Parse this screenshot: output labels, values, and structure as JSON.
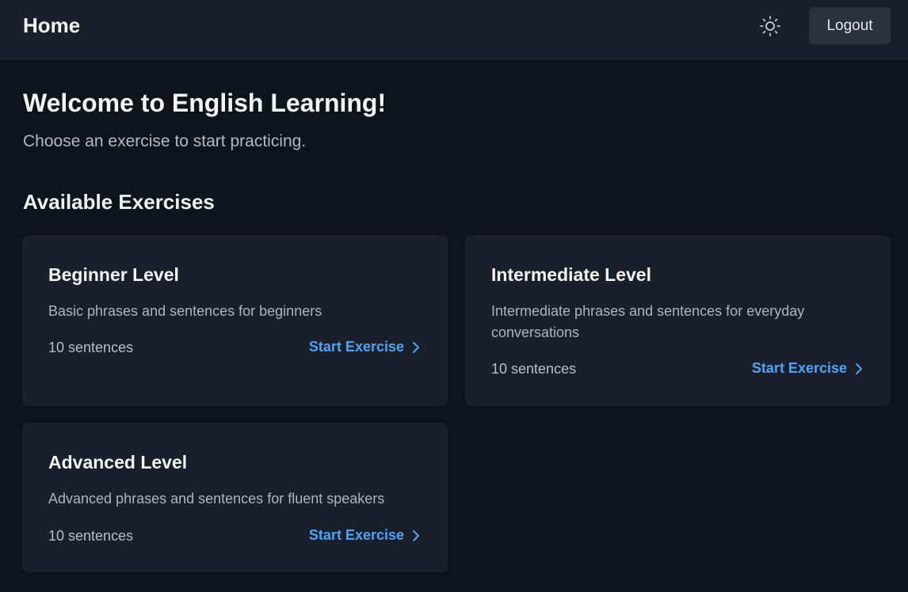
{
  "header": {
    "title": "Home",
    "theme_icon": "sun-icon",
    "logout_label": "Logout"
  },
  "main": {
    "welcome_title": "Welcome to English Learning!",
    "welcome_subtitle": "Choose an exercise to start practicing.",
    "section_title": "Available Exercises",
    "exercises": [
      {
        "title": "Beginner Level",
        "description": "Basic phrases and sentences for beginners",
        "count": "10 sentences",
        "action": "Start Exercise"
      },
      {
        "title": "Intermediate Level",
        "description": "Intermediate phrases and sentences for everyday conversations",
        "count": "10 sentences",
        "action": "Start Exercise"
      },
      {
        "title": "Advanced Level",
        "description": "Advanced phrases and sentences for fluent speakers",
        "count": "10 sentences",
        "action": "Start Exercise"
      }
    ]
  },
  "colors": {
    "background": "#0f131c",
    "surface": "#1a202b",
    "accent": "#4fa3f7",
    "button": "#2b323e"
  }
}
